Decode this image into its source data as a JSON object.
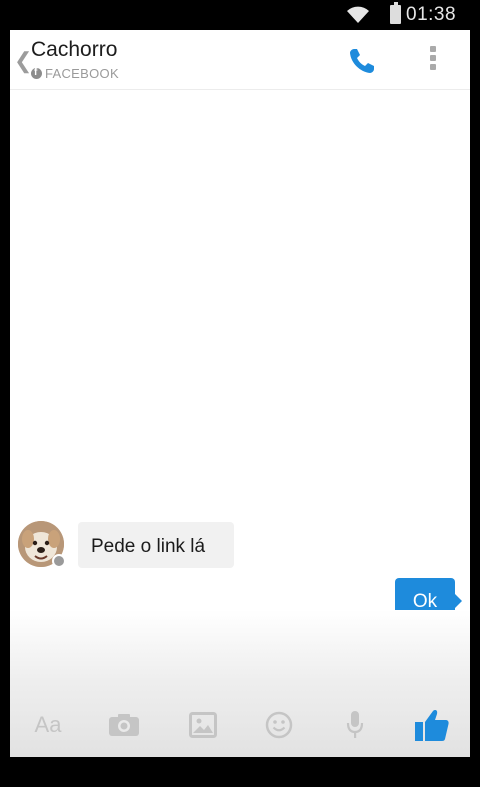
{
  "status_bar": {
    "time": "01:38",
    "icons": [
      "wifi-icon",
      "battery-icon"
    ]
  },
  "header": {
    "title": "Cachorro",
    "subtitle": "FACEBOOK",
    "actions": [
      "call-icon",
      "more-options-icon"
    ]
  },
  "conversation": {
    "messages": [
      {
        "direction": "incoming",
        "text": "Pede o link lá"
      },
      {
        "direction": "outgoing",
        "text": "Ok"
      }
    ]
  },
  "composer": {
    "text_placeholder": "Aa",
    "tools": [
      "text-icon",
      "camera-icon",
      "gallery-icon",
      "emoji-icon",
      "microphone-icon",
      "like-icon"
    ]
  },
  "colors": {
    "accent": "#1e8bdc",
    "incoming_bubble": "#f1f1f1",
    "toolbar_icon": "#c5c5c5"
  }
}
